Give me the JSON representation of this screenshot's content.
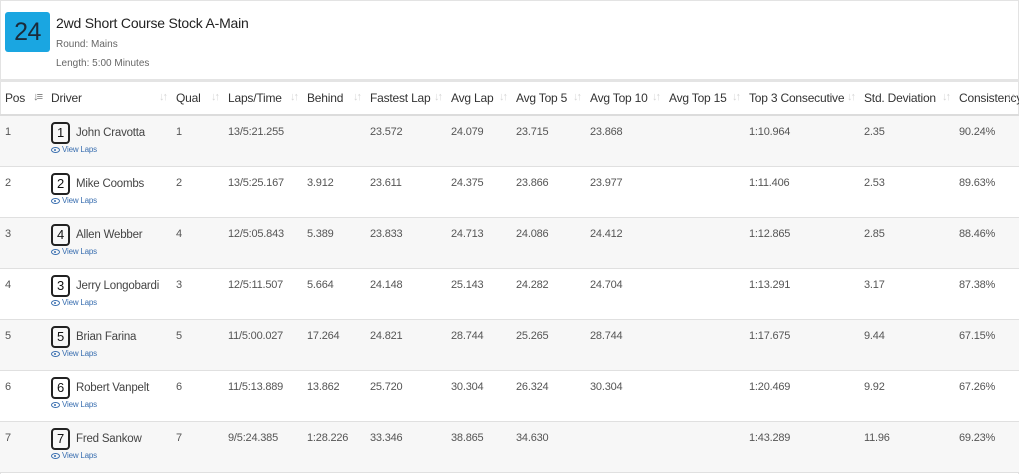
{
  "race": {
    "number": "24",
    "title": "2wd Short Course Stock A-Main",
    "round": "Round: Mains",
    "length": "Length: 5:00 Minutes"
  },
  "columns": [
    "Pos",
    "Driver",
    "Qual",
    "Laps/Time",
    "Behind",
    "Fastest Lap",
    "Avg Lap",
    "Avg Top 5",
    "Avg Top 10",
    "Avg Top 15",
    "Top 3 Consecutive",
    "Std. Deviation",
    "Consistency"
  ],
  "view_laps_label": "View Laps",
  "rows": [
    {
      "pos": "1",
      "car": "1",
      "driver": "John Cravotta",
      "qual": "1",
      "laps_time": "13/5:21.255",
      "behind": "",
      "fastest_lap": "23.572",
      "avg_lap": "24.079",
      "avg_top5": "23.715",
      "avg_top10": "23.868",
      "avg_top15": "",
      "top3_consecutive": "1:10.964",
      "std_dev": "2.35",
      "consistency": "90.24%"
    },
    {
      "pos": "2",
      "car": "2",
      "driver": "Mike Coombs",
      "qual": "2",
      "laps_time": "13/5:25.167",
      "behind": "3.912",
      "fastest_lap": "23.611",
      "avg_lap": "24.375",
      "avg_top5": "23.866",
      "avg_top10": "23.977",
      "avg_top15": "",
      "top3_consecutive": "1:11.406",
      "std_dev": "2.53",
      "consistency": "89.63%"
    },
    {
      "pos": "3",
      "car": "4",
      "driver": "Allen Webber",
      "qual": "4",
      "laps_time": "12/5:05.843",
      "behind": "5.389",
      "fastest_lap": "23.833",
      "avg_lap": "24.713",
      "avg_top5": "24.086",
      "avg_top10": "24.412",
      "avg_top15": "",
      "top3_consecutive": "1:12.865",
      "std_dev": "2.85",
      "consistency": "88.46%"
    },
    {
      "pos": "4",
      "car": "3",
      "driver": "Jerry Longobardi",
      "qual": "3",
      "laps_time": "12/5:11.507",
      "behind": "5.664",
      "fastest_lap": "24.148",
      "avg_lap": "25.143",
      "avg_top5": "24.282",
      "avg_top10": "24.704",
      "avg_top15": "",
      "top3_consecutive": "1:13.291",
      "std_dev": "3.17",
      "consistency": "87.38%"
    },
    {
      "pos": "5",
      "car": "5",
      "driver": "Brian Farina",
      "qual": "5",
      "laps_time": "11/5:00.027",
      "behind": "17.264",
      "fastest_lap": "24.821",
      "avg_lap": "28.744",
      "avg_top5": "25.265",
      "avg_top10": "28.744",
      "avg_top15": "",
      "top3_consecutive": "1:17.675",
      "std_dev": "9.44",
      "consistency": "67.15%"
    },
    {
      "pos": "6",
      "car": "6",
      "driver": "Robert Vanpelt",
      "qual": "6",
      "laps_time": "11/5:13.889",
      "behind": "13.862",
      "fastest_lap": "25.720",
      "avg_lap": "30.304",
      "avg_top5": "26.324",
      "avg_top10": "30.304",
      "avg_top15": "",
      "top3_consecutive": "1:20.469",
      "std_dev": "9.92",
      "consistency": "67.26%"
    },
    {
      "pos": "7",
      "car": "7",
      "driver": "Fred Sankow",
      "qual": "7",
      "laps_time": "9/5:24.385",
      "behind": "1:28.226",
      "fastest_lap": "33.346",
      "avg_lap": "38.865",
      "avg_top5": "34.630",
      "avg_top10": "",
      "avg_top15": "",
      "top3_consecutive": "1:43.289",
      "std_dev": "11.96",
      "consistency": "69.23%"
    }
  ],
  "colors": {
    "badge": "#1aa6e1",
    "link": "#3a6fb0"
  },
  "icons": {
    "sort": "sort-arrows-icon",
    "view": "eye-icon"
  }
}
